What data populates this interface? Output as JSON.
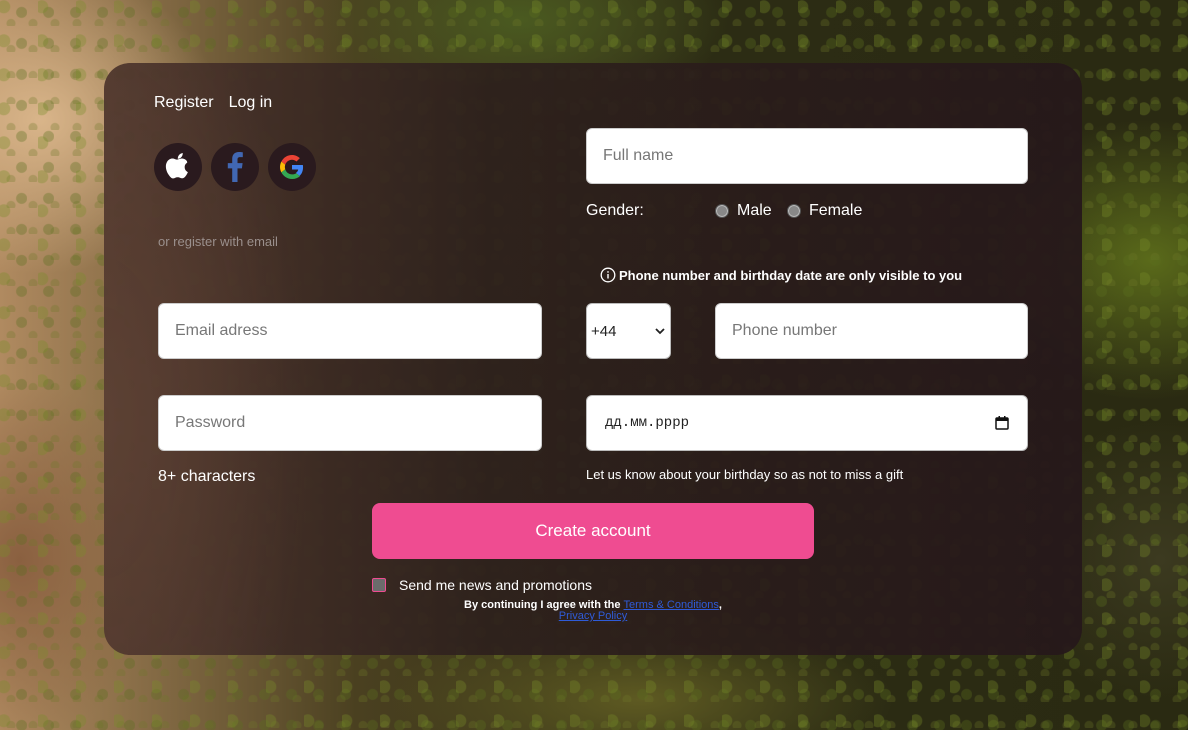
{
  "tabs": {
    "register": "Register",
    "login": "Log in"
  },
  "social": {
    "apple": "apple-icon",
    "facebook": "facebook-icon",
    "google": "google-icon"
  },
  "or_register_email": "or register with email",
  "full_name": {
    "placeholder": "Full name",
    "value": ""
  },
  "gender": {
    "label": "Gender:",
    "options": [
      "Male",
      "Female"
    ],
    "selected": null
  },
  "privacy_note": "Phone number and birthday date are only visible to you",
  "email": {
    "placeholder": "Email adress",
    "value": ""
  },
  "phone": {
    "country_code": "+44",
    "placeholder": "Phone number",
    "value": ""
  },
  "password": {
    "placeholder": "Password",
    "value": "",
    "hint": "8+ characters"
  },
  "birthday": {
    "placeholder": "дд.мм.рррр",
    "hint": "Let us know about your birthday so as not to miss a gift"
  },
  "create_button": "Create account",
  "newsletter": {
    "label": "Send me news and promotions",
    "checked": false
  },
  "legal": {
    "prefix": "By continuing I agree with the ",
    "terms": "Terms & Conditions",
    "separator": ",",
    "privacy": "Privacy Policy"
  },
  "colors": {
    "accent": "#ef4c91",
    "link": "#2f5bd8",
    "card": "#2d201c"
  }
}
